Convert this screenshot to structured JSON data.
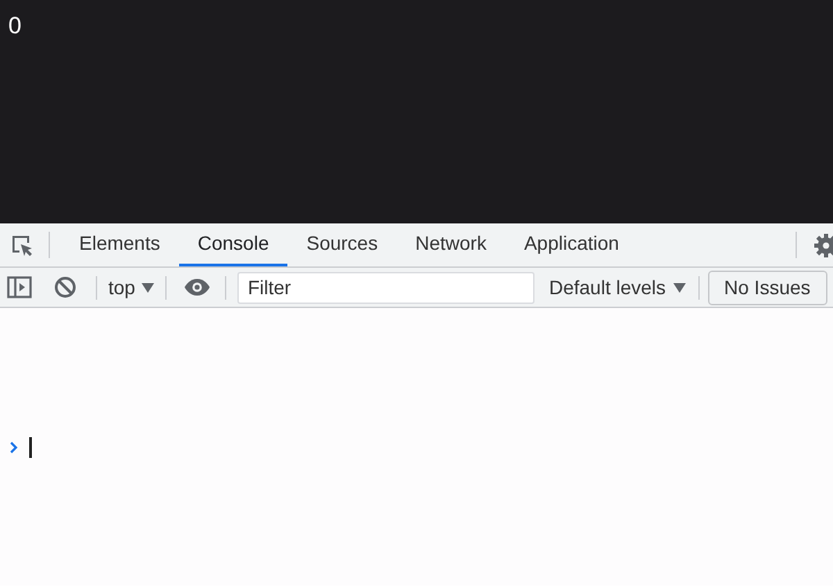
{
  "page": {
    "text": "0"
  },
  "tabs": [
    {
      "label": "Elements",
      "selected": false
    },
    {
      "label": "Console",
      "selected": true
    },
    {
      "label": "Sources",
      "selected": false
    },
    {
      "label": "Network",
      "selected": false
    },
    {
      "label": "Application",
      "selected": false
    }
  ],
  "toolbar": {
    "context": "top",
    "filter": {
      "placeholder": "Filter"
    },
    "levels": "Default levels",
    "issues": "No Issues"
  }
}
